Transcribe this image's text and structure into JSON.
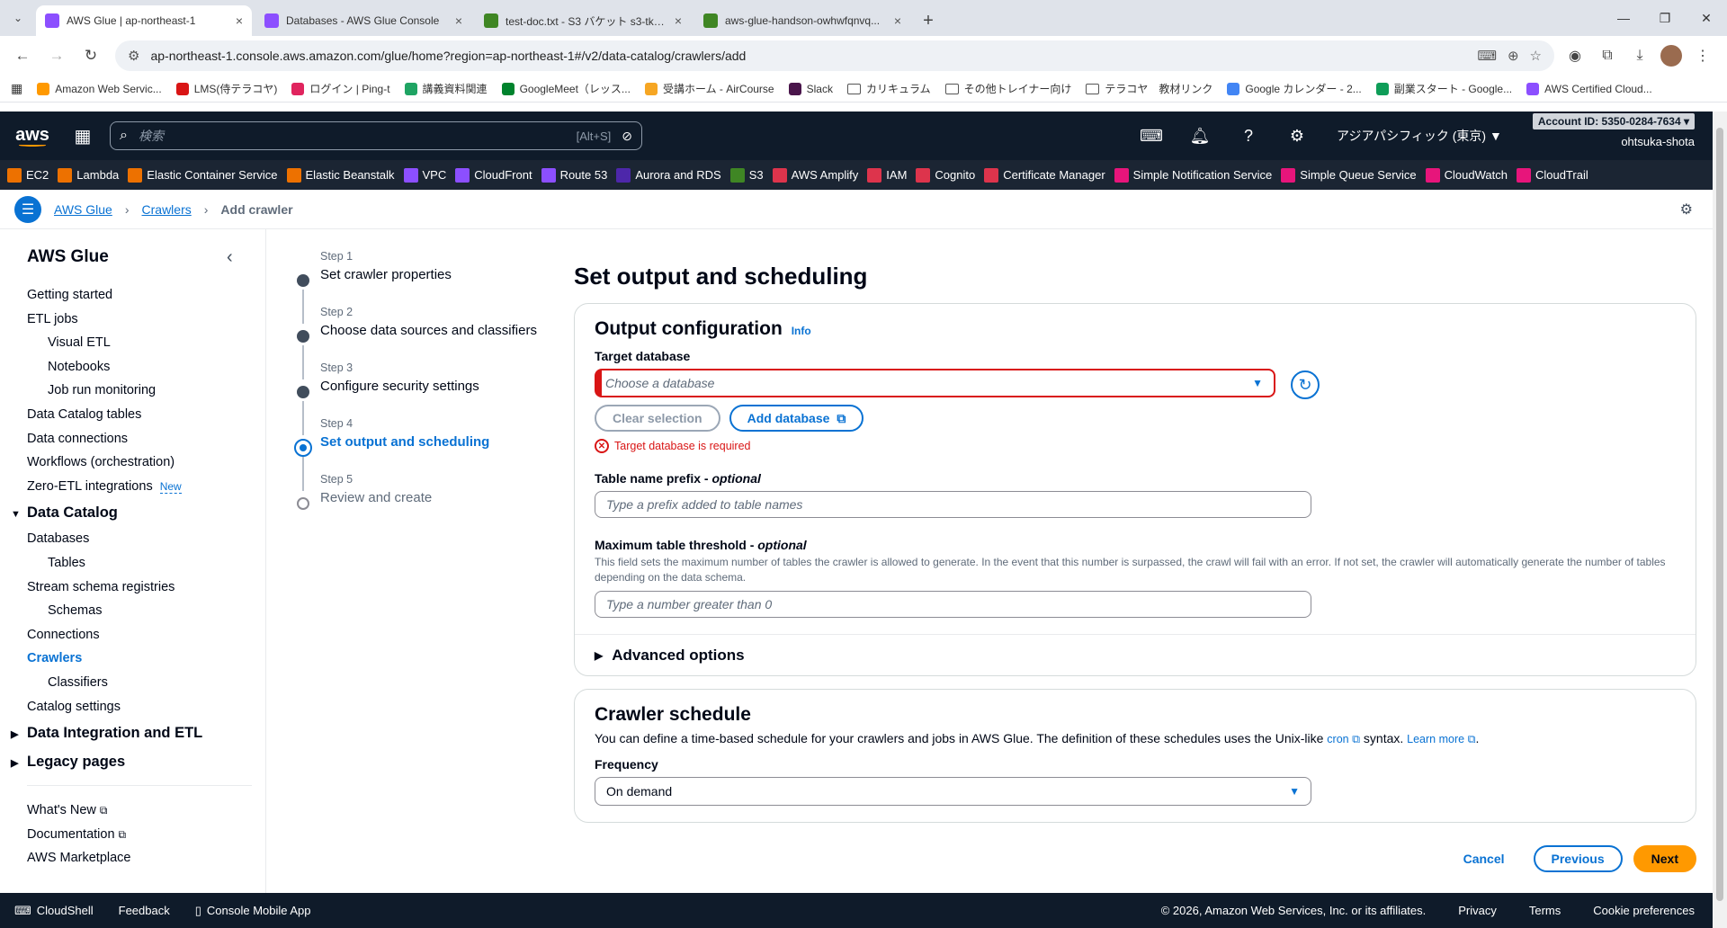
{
  "browser": {
    "tabs": [
      {
        "title": "AWS Glue | ap-northeast-1",
        "color": "#8c4fff",
        "active": true
      },
      {
        "title": "Databases - AWS Glue Console",
        "color": "#8c4fff",
        "active": false
      },
      {
        "title": "test-doc.txt - S3 バケット s3-tky-...",
        "color": "#3f8624",
        "active": false
      },
      {
        "title": "aws-glue-handson-owhwfqnvq...",
        "color": "#3f8624",
        "active": false
      }
    ],
    "url": "ap-northeast-1.console.aws.amazon.com/glue/home?region=ap-northeast-1#/v2/data-catalog/crawlers/add",
    "bookmarks": [
      {
        "label": "Amazon Web Servic...",
        "color": "#ff9900"
      },
      {
        "label": "LMS(侍テラコヤ)",
        "color": "#d91515"
      },
      {
        "label": "ログイン | Ping-t",
        "color": "#e0245e"
      },
      {
        "label": "講義資料関連",
        "color": "#1fa463"
      },
      {
        "label": "GoogleMeet（レッス...",
        "color": "#00832d"
      },
      {
        "label": "受講ホーム - AirCourse",
        "color": "#f6a623"
      },
      {
        "label": "Slack",
        "color": "#4a154b"
      },
      {
        "label": "カリキュラム",
        "color": "#ffffff"
      },
      {
        "label": "その他トレイナー向け",
        "color": "#ffffff"
      },
      {
        "label": "テラコヤ　教材リンク",
        "color": "#ffffff"
      },
      {
        "label": "Google カレンダー - 2...",
        "color": "#4285f4"
      },
      {
        "label": "副業スタート - Google...",
        "color": "#0f9d58"
      },
      {
        "label": "AWS Certified Cloud...",
        "color": "#8c4fff"
      }
    ]
  },
  "aws_header": {
    "logo": "aws",
    "search_placeholder": "検索",
    "search_shortcut": "[Alt+S]",
    "region": "アジアパシフィック (東京) ▼",
    "account_id": "Account ID: 5350-0284-7634 ▾",
    "user": "ohtsuka-shota",
    "services": [
      {
        "label": "EC2",
        "color": "#ed7100"
      },
      {
        "label": "Lambda",
        "color": "#ed7100"
      },
      {
        "label": "Elastic Container Service",
        "color": "#ed7100"
      },
      {
        "label": "Elastic Beanstalk",
        "color": "#ed7100"
      },
      {
        "label": "VPC",
        "color": "#8c4fff"
      },
      {
        "label": "CloudFront",
        "color": "#8c4fff"
      },
      {
        "label": "Route 53",
        "color": "#8c4fff"
      },
      {
        "label": "Aurora and RDS",
        "color": "#4d27aa"
      },
      {
        "label": "S3",
        "color": "#3f8624"
      },
      {
        "label": "AWS Amplify",
        "color": "#dd344c"
      },
      {
        "label": "IAM",
        "color": "#dd344c"
      },
      {
        "label": "Cognito",
        "color": "#dd344c"
      },
      {
        "label": "Certificate Manager",
        "color": "#dd344c"
      },
      {
        "label": "Simple Notification Service",
        "color": "#e7157b"
      },
      {
        "label": "Simple Queue Service",
        "color": "#e7157b"
      },
      {
        "label": "CloudWatch",
        "color": "#e7157b"
      },
      {
        "label": "CloudTrail",
        "color": "#e7157b"
      }
    ]
  },
  "breadcrumb": {
    "items": [
      "AWS Glue",
      "Crawlers"
    ],
    "current": "Add crawler"
  },
  "sidenav": {
    "title": "AWS Glue",
    "items": [
      {
        "label": "Getting started",
        "level": 0
      },
      {
        "label": "ETL jobs",
        "level": 0
      },
      {
        "label": "Visual ETL",
        "level": 1
      },
      {
        "label": "Notebooks",
        "level": 1
      },
      {
        "label": "Job run monitoring",
        "level": 1
      },
      {
        "label": "Data Catalog tables",
        "level": 0
      },
      {
        "label": "Data connections",
        "level": 0
      },
      {
        "label": "Workflows (orchestration)",
        "level": 0
      },
      {
        "label": "Zero-ETL integrations",
        "level": 0,
        "badge": "New"
      },
      {
        "label": "Data Catalog",
        "level": -1,
        "expanded": true
      },
      {
        "label": "Databases",
        "level": 0
      },
      {
        "label": "Tables",
        "level": 1
      },
      {
        "label": "Stream schema registries",
        "level": 0
      },
      {
        "label": "Schemas",
        "level": 1
      },
      {
        "label": "Connections",
        "level": 0
      },
      {
        "label": "Crawlers",
        "level": 0,
        "active": true
      },
      {
        "label": "Classifiers",
        "level": 1
      },
      {
        "label": "Catalog settings",
        "level": 0
      },
      {
        "label": "Data Integration and ETL",
        "level": -1,
        "expanded": false
      },
      {
        "label": "Legacy pages",
        "level": -1,
        "expanded": false
      }
    ],
    "footer_links": [
      {
        "label": "What's New",
        "external": true
      },
      {
        "label": "Documentation",
        "external": true
      },
      {
        "label": "AWS Marketplace",
        "external": false
      }
    ]
  },
  "steps": [
    {
      "num": "Step 1",
      "label": "Set crawler properties",
      "state": "done"
    },
    {
      "num": "Step 2",
      "label": "Choose data sources and classifiers",
      "state": "done"
    },
    {
      "num": "Step 3",
      "label": "Configure security settings",
      "state": "done"
    },
    {
      "num": "Step 4",
      "label": "Set output and scheduling",
      "state": "current"
    },
    {
      "num": "Step 5",
      "label": "Review and create",
      "state": "future"
    }
  ],
  "main": {
    "page_title": "Set output and scheduling",
    "output": {
      "title": "Output configuration",
      "info": "Info",
      "target_db_label": "Target database",
      "target_db_placeholder": "Choose a database",
      "clear_selection": "Clear selection",
      "add_database": "Add database",
      "error": "Target database is required",
      "prefix_label": "Table name prefix - ",
      "prefix_optional": "optional",
      "prefix_placeholder": "Type a prefix added to table names",
      "threshold_label": "Maximum table threshold - ",
      "threshold_optional": "optional",
      "threshold_desc": "This field sets the maximum number of tables the crawler is allowed to generate. In the event that this number is surpassed, the crawl will fail with an error. If not set, the crawler will automatically generate the number of tables depending on the data schema.",
      "threshold_placeholder": "Type a number greater than 0",
      "advanced": "Advanced options"
    },
    "schedule": {
      "title": "Crawler schedule",
      "desc_before": "You can define a time-based schedule for your crawlers and jobs in AWS Glue. The definition of these schedules uses the Unix-like ",
      "cron_link": "cron",
      "desc_after": " syntax. ",
      "learn_more": "Learn more",
      "frequency_label": "Frequency",
      "frequency_value": "On demand"
    },
    "actions": {
      "cancel": "Cancel",
      "previous": "Previous",
      "next": "Next"
    }
  },
  "footer": {
    "cloudshell": "CloudShell",
    "feedback": "Feedback",
    "mobile": "Console Mobile App",
    "copyright": "© 2026, Amazon Web Services, Inc. or its affiliates.",
    "links": [
      "Privacy",
      "Terms",
      "Cookie preferences"
    ]
  }
}
